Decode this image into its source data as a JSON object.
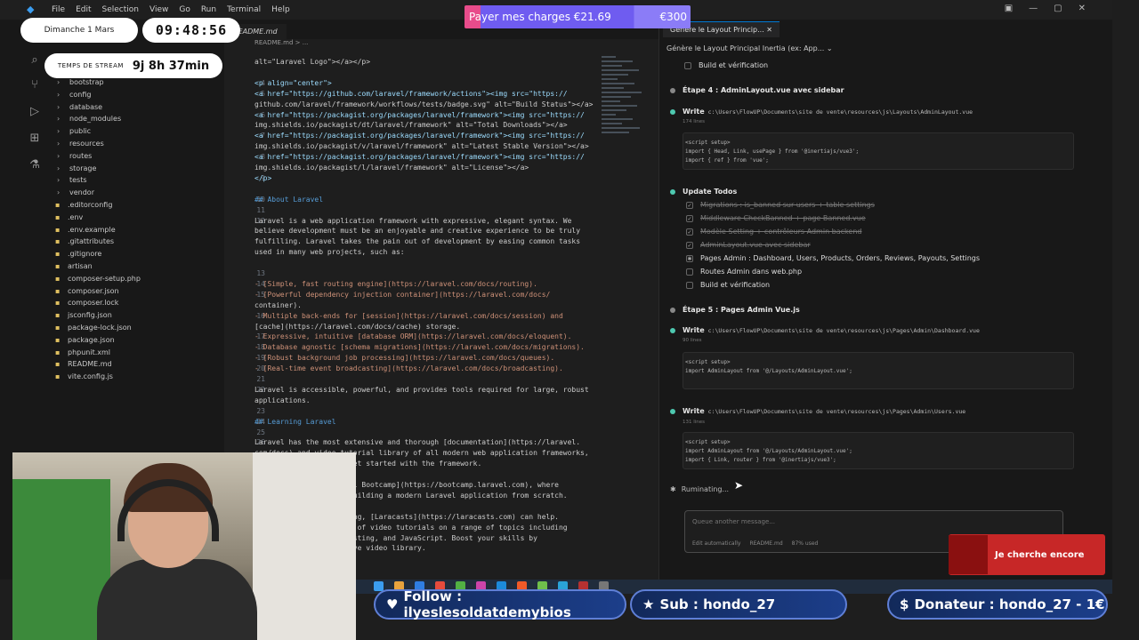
{
  "window": {
    "menu": [
      "File",
      "Edit",
      "Selection",
      "View",
      "Go",
      "Run",
      "Terminal",
      "Help"
    ]
  },
  "overlay": {
    "date": "Dimanche 1 Mars",
    "time": "09:48:56",
    "stream_label": "TEMPS DE STREAM",
    "stream_value": "9j 8h 37min",
    "charges_label": "Payer mes charges €21.69",
    "charges_goal": "€300",
    "follow": "Follow : ilyeslesoldatdemybios",
    "sub": "Sub : hondo_27",
    "donateur": "Donateur : hondo_27 - 1€",
    "notification": "Je cherche encore"
  },
  "explorer": {
    "items": [
      {
        "name": "bootstrap",
        "type": "folder"
      },
      {
        "name": "config",
        "type": "folder"
      },
      {
        "name": "database",
        "type": "folder"
      },
      {
        "name": "node_modules",
        "type": "folder"
      },
      {
        "name": "public",
        "type": "folder"
      },
      {
        "name": "resources",
        "type": "folder"
      },
      {
        "name": "routes",
        "type": "folder"
      },
      {
        "name": "storage",
        "type": "folder"
      },
      {
        "name": "tests",
        "type": "folder"
      },
      {
        "name": "vendor",
        "type": "folder"
      },
      {
        "name": ".editorconfig",
        "type": "file"
      },
      {
        "name": ".env",
        "type": "file"
      },
      {
        "name": ".env.example",
        "type": "file"
      },
      {
        "name": ".gitattributes",
        "type": "file"
      },
      {
        "name": ".gitignore",
        "type": "file"
      },
      {
        "name": "artisan",
        "type": "file"
      },
      {
        "name": "composer-setup.php",
        "type": "file"
      },
      {
        "name": "composer.json",
        "type": "file"
      },
      {
        "name": "composer.lock",
        "type": "file"
      },
      {
        "name": "jsconfig.json",
        "type": "file"
      },
      {
        "name": "package-lock.json",
        "type": "file"
      },
      {
        "name": "package.json",
        "type": "file"
      },
      {
        "name": "phpunit.xml",
        "type": "file"
      },
      {
        "name": "README.md",
        "type": "file"
      },
      {
        "name": "vite.config.js",
        "type": "file"
      }
    ]
  },
  "editor": {
    "tab": "README.md",
    "breadcrumb": "README.md > ...",
    "lines": [
      {
        "n": "",
        "t": "alt=\"Laravel Logo\"></a></p>"
      },
      {
        "n": "",
        "t": ""
      },
      {
        "n": "4",
        "t": "<p align=\"center\">"
      },
      {
        "n": "5",
        "t": "<a href=\"https://github.com/laravel/framework/actions\"><img src=\"https://"
      },
      {
        "n": "",
        "t": "github.com/laravel/framework/workflows/tests/badge.svg\" alt=\"Build Status\"></a>"
      },
      {
        "n": "6",
        "t": "<a href=\"https://packagist.org/packages/laravel/framework\"><img src=\"https://"
      },
      {
        "n": "",
        "t": "img.shields.io/packagist/dt/laravel/framework\" alt=\"Total Downloads\"></a>"
      },
      {
        "n": "7",
        "t": "<a href=\"https://packagist.org/packages/laravel/framework\"><img src=\"https://"
      },
      {
        "n": "",
        "t": "img.shields.io/packagist/v/laravel/framework\" alt=\"Latest Stable Version\"></a>"
      },
      {
        "n": "8",
        "t": "<a href=\"https://packagist.org/packages/laravel/framework\"><img src=\"https://"
      },
      {
        "n": "",
        "t": "img.shields.io/packagist/l/laravel/framework\" alt=\"License\"></a>"
      },
      {
        "n": "9",
        "t": "</p>"
      },
      {
        "n": "",
        "t": ""
      },
      {
        "n": "10",
        "t": "## About Laravel"
      },
      {
        "n": "11",
        "t": ""
      },
      {
        "n": "12",
        "t": "Laravel is a web application framework with expressive, elegant syntax. We"
      },
      {
        "n": "",
        "t": "believe development must be an enjoyable and creative experience to be truly"
      },
      {
        "n": "",
        "t": "fulfilling. Laravel takes the pain out of development by easing common tasks"
      },
      {
        "n": "",
        "t": "used in many web projects, such as:"
      },
      {
        "n": "",
        "t": ""
      },
      {
        "n": "13",
        "t": ""
      },
      {
        "n": "14",
        "t": "- [Simple, fast routing engine](https://laravel.com/docs/routing)."
      },
      {
        "n": "15",
        "t": "- [Powerful dependency injection container](https://laravel.com/docs/"
      },
      {
        "n": "",
        "t": "container)."
      },
      {
        "n": "16",
        "t": "- Multiple back-ends for [session](https://laravel.com/docs/session) and"
      },
      {
        "n": "",
        "t": "[cache](https://laravel.com/docs/cache) storage."
      },
      {
        "n": "17",
        "t": "- Expressive, intuitive [database ORM](https://laravel.com/docs/eloquent)."
      },
      {
        "n": "18",
        "t": "- Database agnostic [schema migrations](https://laravel.com/docs/migrations)."
      },
      {
        "n": "19",
        "t": "- [Robust background job processing](https://laravel.com/docs/queues)."
      },
      {
        "n": "20",
        "t": "- [Real-time event broadcasting](https://laravel.com/docs/broadcasting)."
      },
      {
        "n": "21",
        "t": ""
      },
      {
        "n": "22",
        "t": "Laravel is accessible, powerful, and provides tools required for large, robust"
      },
      {
        "n": "",
        "t": "applications."
      },
      {
        "n": "23",
        "t": ""
      },
      {
        "n": "24",
        "t": "## Learning Laravel"
      },
      {
        "n": "25",
        "t": ""
      },
      {
        "n": "26",
        "t": "Laravel has the most extensive and thorough [documentation](https://laravel."
      },
      {
        "n": "",
        "t": "com/docs) and video tutorial library of all modern web application frameworks,"
      },
      {
        "n": "",
        "t": "making it a breeze to get started with the framework."
      },
      {
        "n": "",
        "t": ""
      },
      {
        "n": "",
        "t": "                   ravel Bootcamp](https://bootcamp.laravel.com), where"
      },
      {
        "n": "",
        "t": "                   gh building a modern Laravel application from scratch."
      },
      {
        "n": "",
        "t": ""
      },
      {
        "n": "",
        "t": "                   eading, [Laracasts](https://laracasts.com) can help."
      },
      {
        "n": "",
        "t": "                   ands of video tutorials on a range of topics including"
      },
      {
        "n": "",
        "t": "                   t testing, and JavaScript. Boost your skills by"
      },
      {
        "n": "",
        "t": "                   ensive video library."
      }
    ]
  },
  "chat": {
    "tab_title": "Génère le Layout Princip...",
    "subtitle": "Génère le Layout Principal Inertia (ex: App...",
    "item_top": "Build et vérification",
    "step4": "Étape 4 : AdminLayout.vue avec sidebar",
    "write1": {
      "label": "Write",
      "path": "c:\\Users\\FlowUP\\Documents\\site de vente\\resources\\js\\Layouts\\AdminLayout.vue",
      "lines": "174 lines",
      "code": "<script setup>\nimport { Head, Link, usePage } from '@inertiajs/vue3';\nimport { ref } from 'vue';"
    },
    "update_todos": "Update Todos",
    "todos": [
      {
        "label": "Migrations : is_banned sur users + table settings",
        "done": true
      },
      {
        "label": "Middleware CheckBanned + page Banned.vue",
        "done": true
      },
      {
        "label": "Modèle Setting + contrôleurs Admin backend",
        "done": true
      },
      {
        "label": "AdminLayout.vue avec sidebar",
        "done": true
      },
      {
        "label": "Pages Admin : Dashboard, Users, Products, Orders, Reviews, Payouts, Settings",
        "done": false,
        "active": true
      },
      {
        "label": "Routes Admin dans web.php",
        "done": false
      },
      {
        "label": "Build et vérification",
        "done": false
      }
    ],
    "step5": "Étape 5 : Pages Admin Vue.js",
    "write2": {
      "label": "Write",
      "path": "c:\\Users\\FlowUP\\Documents\\site de vente\\resources\\js\\Pages\\Admin\\Dashboard.vue",
      "lines": "90 lines",
      "code": "<script setup>\nimport AdminLayout from '@/Layouts/AdminLayout.vue';"
    },
    "write3": {
      "label": "Write",
      "path": "c:\\Users\\FlowUP\\Documents\\site de vente\\resources\\js\\Pages\\Admin\\Users.vue",
      "lines": "131 lines",
      "code": "<script setup>\nimport AdminLayout from '@/Layouts/AdminLayout.vue';\nimport { Link, router } from '@inertiajs/vue3';"
    },
    "status": "Ruminating...",
    "input_placeholder": "Queue another message...",
    "footer": {
      "edit": "Edit automatically",
      "file": "README.md",
      "usage": "87% used"
    }
  },
  "colors": {
    "accent": "#0078d4",
    "done": "#4ec9b0",
    "charges_bar": "#6f5cf0",
    "pill": "#1c3e8a"
  }
}
